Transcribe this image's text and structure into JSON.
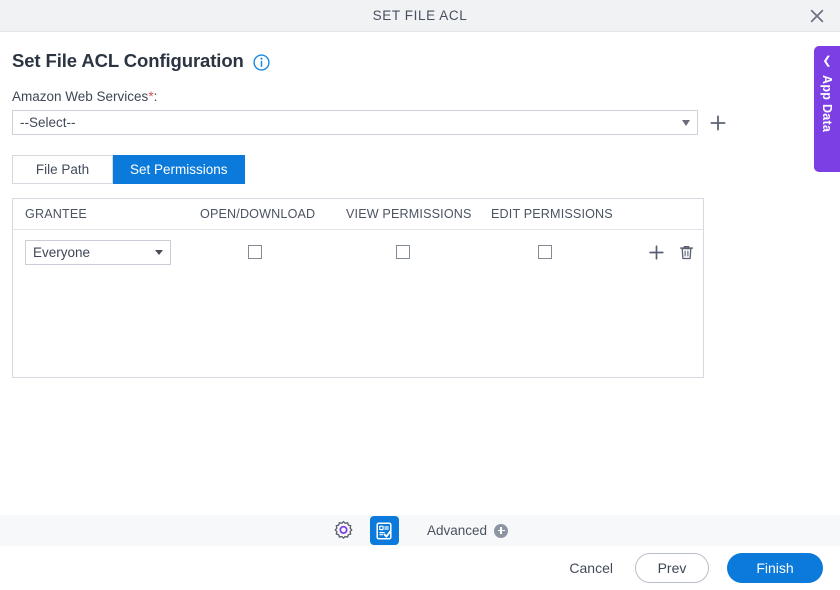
{
  "window": {
    "title": "SET FILE ACL",
    "close_icon": "close-icon"
  },
  "header": {
    "page_title": "Set File ACL Configuration",
    "info_icon": "info-icon"
  },
  "form": {
    "aws_label": "Amazon Web Services",
    "required_marker": "*",
    "aws_label_colon": ":",
    "aws_select_value": "--Select--",
    "add_icon": "plus-icon"
  },
  "tabs": [
    {
      "label": "File Path",
      "active": false
    },
    {
      "label": "Set Permissions",
      "active": true
    }
  ],
  "table": {
    "columns": [
      "GRANTEE",
      "OPEN/DOWNLOAD",
      "VIEW PERMISSIONS",
      "EDIT PERMISSIONS"
    ],
    "rows": [
      {
        "grantee": "Everyone",
        "open_download": false,
        "view_permissions": false,
        "edit_permissions": false,
        "add_icon": "plus-icon",
        "delete_icon": "trash-icon"
      }
    ]
  },
  "side_panel": {
    "label": "App Data",
    "chevron_icon": "chevron-left-icon"
  },
  "toolbar": {
    "settings_icon": "gear-icon",
    "form_icon": "form-checklist-icon",
    "advanced_label": "Advanced",
    "advanced_add_icon": "plus-circle-icon"
  },
  "footer": {
    "cancel_label": "Cancel",
    "prev_label": "Prev",
    "finish_label": "Finish"
  },
  "colors": {
    "accent_blue": "#0b7ada",
    "app_data_purple": "#7b3fe4",
    "required_red": "#d9534f",
    "titlebar_bg": "#f1f2f4",
    "toolbar_bg": "#f7f8fa"
  }
}
